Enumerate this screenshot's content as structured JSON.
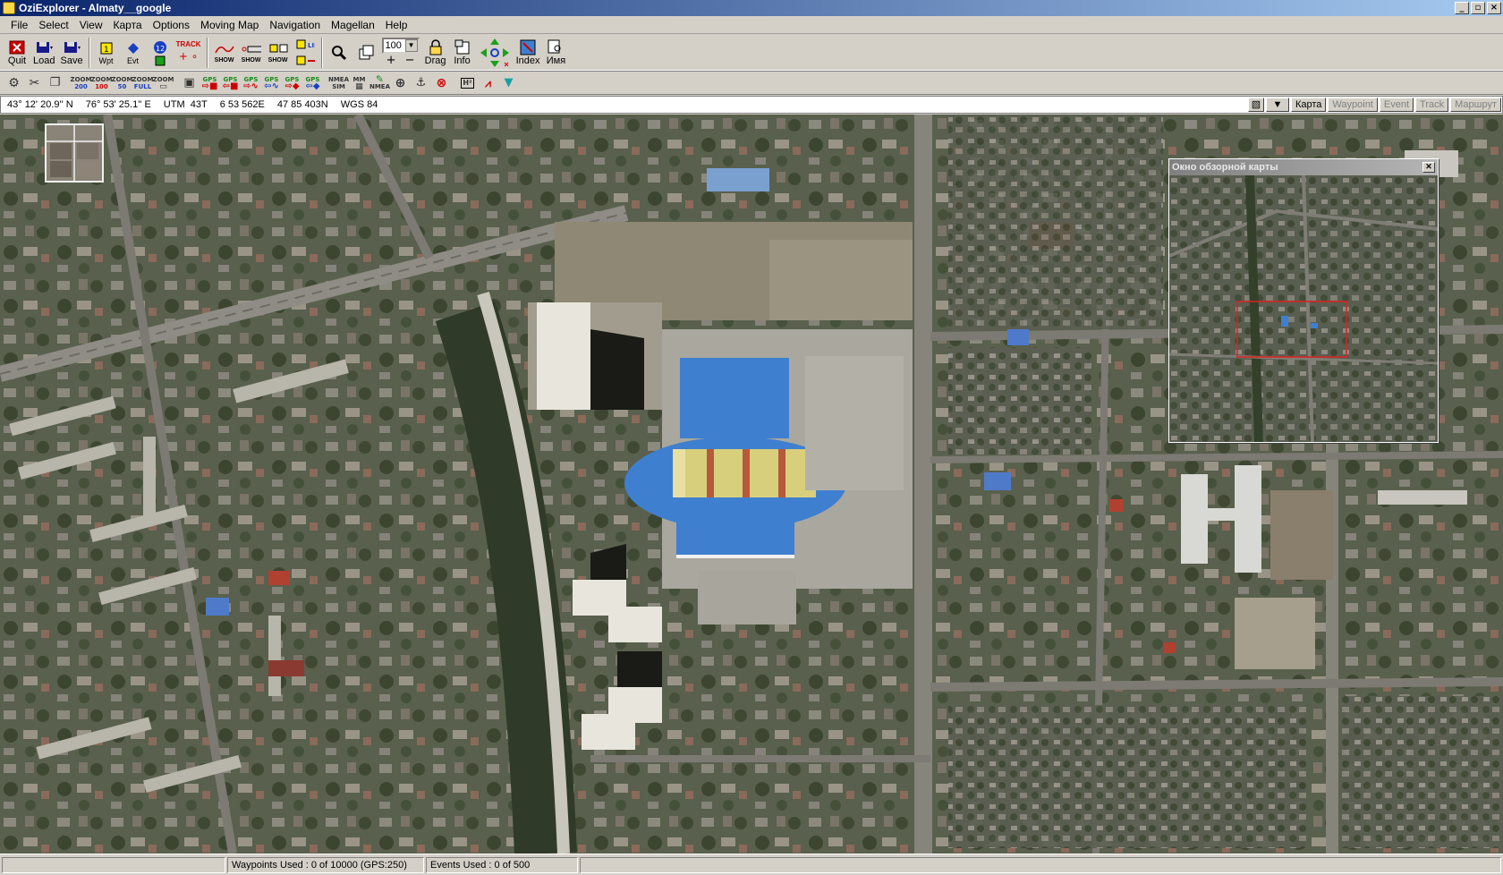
{
  "window": {
    "title": "OziExplorer - Almaty__google",
    "minimize": "_",
    "restore": "▫",
    "close": "×"
  },
  "menu": [
    "File",
    "Select",
    "View",
    "Карта",
    "Options",
    "Moving Map",
    "Navigation",
    "Magellan",
    "Help"
  ],
  "toolbar": {
    "quit": "Quit",
    "load": "Load",
    "save": "Save",
    "wpt": "Wpt",
    "evt": "Evt",
    "track_label": "TRACK",
    "show1": "SHOW",
    "show2": "SHOW",
    "show3": "SHOW",
    "line_label": "LINE",
    "zoom_value": "100",
    "drag": "Drag",
    "info": "Info",
    "index": "Index",
    "name": "Имя"
  },
  "toolbar2": {
    "zoom200": [
      "ZOOM",
      "200"
    ],
    "zoom100": [
      "ZOOM",
      "100"
    ],
    "zoom50": [
      "ZOOM",
      "50"
    ],
    "zoomfull": [
      "ZOOM",
      "FULL"
    ],
    "zoom_plain": "ZOOM",
    "gps": "GPS",
    "nmea_sim": [
      "NMEA",
      "SIM"
    ],
    "mm": "MM",
    "nmea": "NMEA",
    "h2": "H²"
  },
  "coords": {
    "lat": "43° 12' 20.9'' N",
    "lon": "76° 53' 25.1'' E",
    "utm": "UTM  43T",
    "easting": "6 53 562E",
    "northing": "47 85 403N",
    "datum": "WGS 84"
  },
  "mode_tabs": [
    "Карта",
    "Waypoint",
    "Event",
    "Track",
    "Маршрут"
  ],
  "mode_active": "Карта",
  "overview": {
    "title": "Окно обзорной карты"
  },
  "status": {
    "waypoints": "Waypoints Used : 0 of 10000  (GPS:250)",
    "events": "Events Used : 0 of 500"
  },
  "colors": {
    "titlebar": "#0a246a",
    "window_bg": "#d4d0c8",
    "overview_frame": "#e02020",
    "map_roof": "#3f7fd0"
  }
}
